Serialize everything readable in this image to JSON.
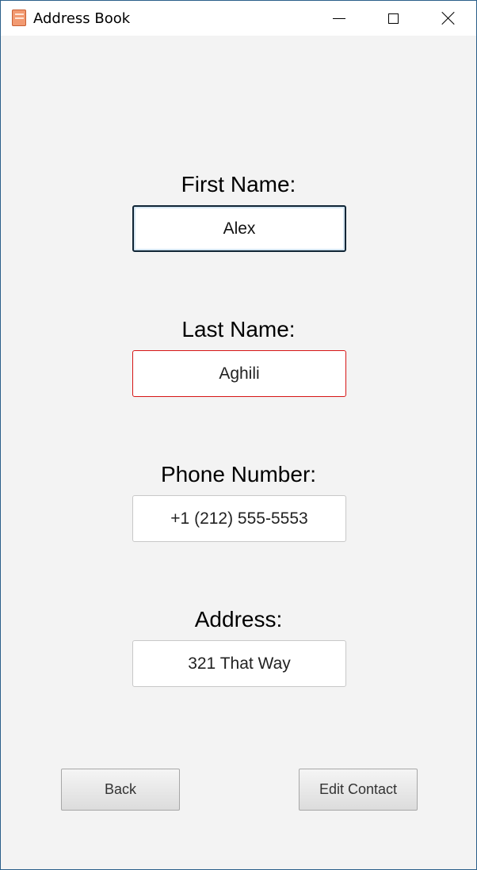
{
  "window": {
    "title": "Address Book",
    "icon": "address-book-icon",
    "controls": [
      "minimize-icon",
      "maximize-icon",
      "close-icon"
    ]
  },
  "form": {
    "first_name": {
      "label": "First Name:",
      "value": "Alex",
      "state": "focused"
    },
    "last_name": {
      "label": "Last Name:",
      "value": "Aghili",
      "state": "invalid"
    },
    "phone_number": {
      "label": "Phone Number:",
      "value": "+1 (212) 555-5553",
      "state": "normal"
    },
    "address": {
      "label": "Address:",
      "value": "321 That Way",
      "state": "normal"
    }
  },
  "buttons": {
    "back_label": "Back",
    "edit_label": "Edit Contact"
  },
  "colors": {
    "background": "#f3f3f3",
    "focus_border": "#102535",
    "invalid_border": "#d61515"
  }
}
